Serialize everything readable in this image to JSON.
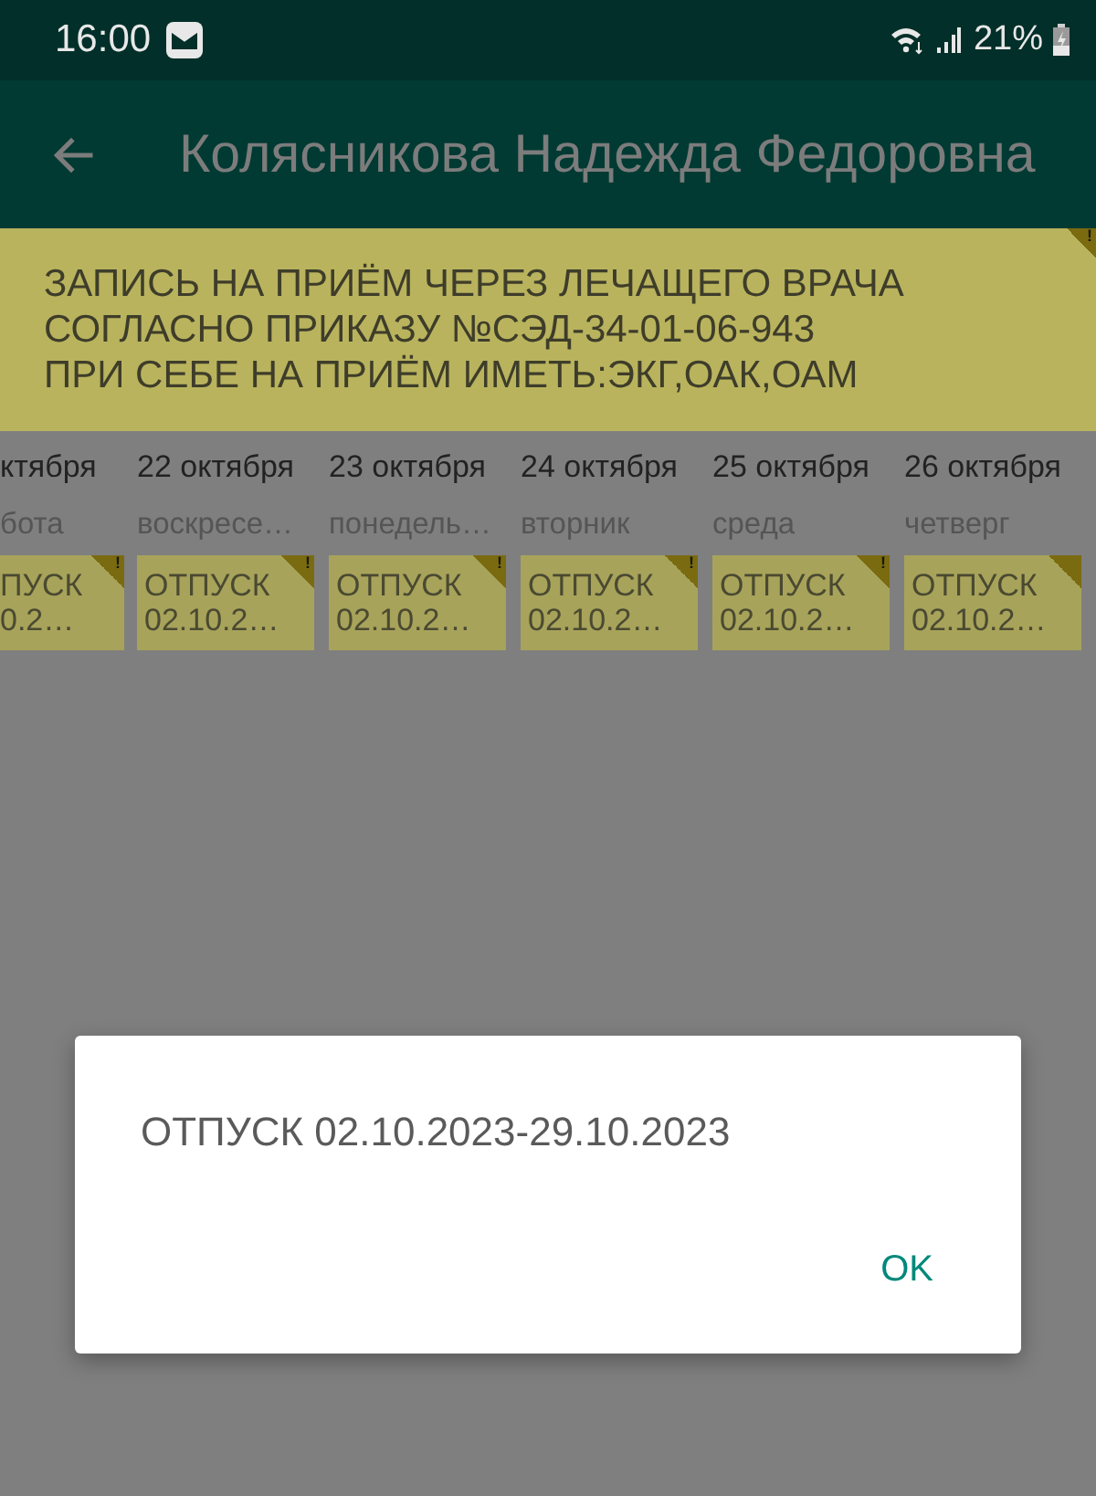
{
  "status_bar": {
    "time": "16:00",
    "battery": "21%"
  },
  "app_bar": {
    "title": "Колясникова Надежда Федоровна"
  },
  "notice": {
    "lines": [
      "ЗАПИСЬ НА ПРИЁМ ЧЕРЕЗ ЛЕЧАЩЕГО ВРАЧА",
      "СОГЛАСНО ПРИКАЗУ №СЭД-34-01-06-943",
      "ПРИ СЕБЕ НА ПРИЁМ ИМЕТЬ:ЭКГ,ОАК,ОАМ"
    ],
    "mark": "!"
  },
  "days": [
    {
      "date": "ктября",
      "weekday": "бота",
      "cut_left": true,
      "slot": {
        "line_1": "ПУСК",
        "line_2": "0.2…",
        "mark": "!"
      }
    },
    {
      "date": "22 октября",
      "weekday": "воскресе…",
      "cut_left": false,
      "slot": {
        "line_1": "ОТПУСК",
        "line_2": "02.10.2…",
        "mark": "!"
      }
    },
    {
      "date": "23 октября",
      "weekday": "понедель…",
      "cut_left": false,
      "slot": {
        "line_1": "ОТПУСК",
        "line_2": "02.10.2…",
        "mark": "!"
      }
    },
    {
      "date": "24 октября",
      "weekday": "вторник",
      "cut_left": false,
      "slot": {
        "line_1": "ОТПУСК",
        "line_2": "02.10.2…",
        "mark": "!"
      }
    },
    {
      "date": "25 октября",
      "weekday": "среда",
      "cut_left": false,
      "slot": {
        "line_1": "ОТПУСК",
        "line_2": "02.10.2…",
        "mark": "!"
      }
    },
    {
      "date": "26 октября",
      "weekday": "четверг",
      "cut_left": false,
      "slot": {
        "line_1": "ОТПУСК",
        "line_2": "02.10.2…"
      }
    }
  ],
  "dialog": {
    "message": "ОТПУСК 02.10.2023-29.10.2023",
    "button": "OK"
  }
}
